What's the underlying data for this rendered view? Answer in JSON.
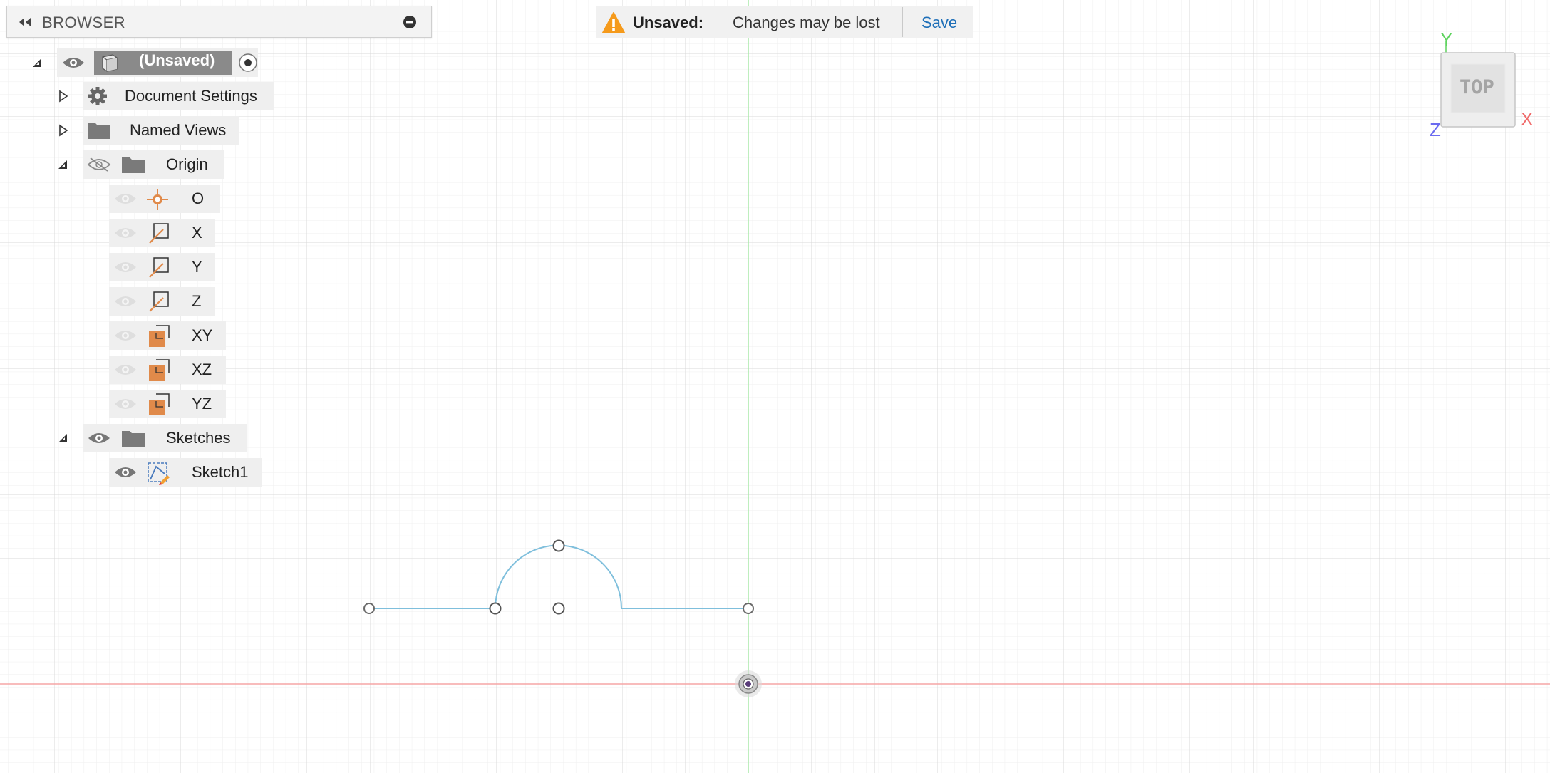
{
  "browser": {
    "title": "BROWSER",
    "root_label": "(Unsaved)",
    "items": {
      "document_settings": "Document Settings",
      "named_views": "Named Views",
      "origin": "Origin",
      "origin_o": "O",
      "origin_x": "X",
      "origin_y": "Y",
      "origin_z": "Z",
      "origin_xy": "XY",
      "origin_xz": "XZ",
      "origin_yz": "YZ",
      "sketches": "Sketches",
      "sketch1": "Sketch1"
    }
  },
  "banner": {
    "status": "Unsaved:",
    "message": "Changes may be lost",
    "save_label": "Save"
  },
  "viewcube": {
    "face_label": "TOP",
    "axis_x": "X",
    "axis_y": "Y",
    "axis_z": "Z"
  },
  "icons": {
    "collapse": "double-chevron-left-icon",
    "minimize": "minus-circle-icon",
    "visibility": "eye-icon",
    "hidden": "eye-slash-icon",
    "component": "cube-icon",
    "activate": "radio-dot-icon",
    "settings": "gear-icon",
    "folder": "folder-icon",
    "point": "origin-point-icon",
    "axis": "axis-line-icon",
    "plane": "plane-icon",
    "sketch": "sketch-icon",
    "warning": "warning-triangle-icon"
  },
  "colors": {
    "grid_minor": "#eeeeee",
    "grid_major": "#d8d8d8",
    "axis_red": "#f5a0a0",
    "axis_green": "#a6e6a6",
    "sketch_line": "#7fbfdc",
    "origin_orange": "#e08a4a",
    "axis_x_color": "#f06a6a",
    "axis_y_color": "#5fd35f",
    "axis_z_color": "#6b6bf0",
    "save_link": "#1e6fb8"
  }
}
